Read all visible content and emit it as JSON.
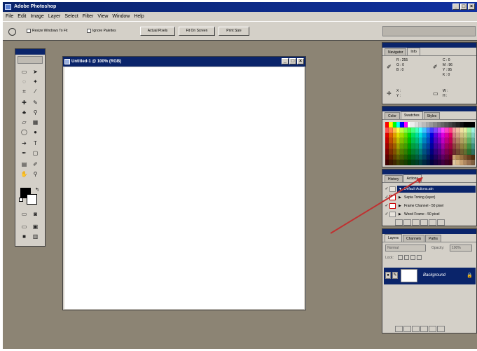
{
  "app": {
    "title": "Adobe Photoshop"
  },
  "menu": [
    "File",
    "Edit",
    "Image",
    "Layer",
    "Select",
    "Filter",
    "View",
    "Window",
    "Help"
  ],
  "options_bar": {
    "checkbox1": "Resize Windows To Fit",
    "checkbox2": "Ignore Palettes",
    "btn_actual": "Actual Pixels",
    "btn_fit": "Fit On Screen",
    "btn_print": "Print Size"
  },
  "document": {
    "title": "Untitled-1 @ 100% (RGB)"
  },
  "navigator": {
    "tabs": [
      "Navigator",
      "Info"
    ],
    "r": "R :",
    "r_val": "255",
    "g": "G :",
    "g_val": "0",
    "b": "B :",
    "b_val": "0",
    "c": "C :",
    "c_val": "0",
    "m": "M :",
    "m_val": "96",
    "y": "Y :",
    "y_val": "95",
    "k": "K :",
    "k_val": "0",
    "x": "X :",
    "y2": "Y :",
    "w": "W :",
    "h": "H :"
  },
  "color_panel": {
    "tabs": [
      "Color",
      "Swatches",
      "Styles"
    ],
    "swatches": [
      "#ff0000",
      "#ffff00",
      "#00ff00",
      "#00ffff",
      "#0000ff",
      "#ff00ff",
      "#ffffff",
      "#eeeeee",
      "#dddddd",
      "#cccccc",
      "#bbbbbb",
      "#aaaaaa",
      "#999999",
      "#888888",
      "#777777",
      "#666666",
      "#555555",
      "#444444",
      "#333333",
      "#222222",
      "#111111",
      "#000000",
      "#000000",
      "#000000",
      "#ff4d4d",
      "#ff8040",
      "#ffc040",
      "#ffff40",
      "#c0ff40",
      "#80ff40",
      "#40ff40",
      "#40ff80",
      "#40ffc0",
      "#40ffff",
      "#40c0ff",
      "#4080ff",
      "#4040ff",
      "#8040ff",
      "#c040ff",
      "#ff40ff",
      "#ff40c0",
      "#ff4080",
      "#f0a0a0",
      "#f0c0a0",
      "#f0e0a0",
      "#e0f0a0",
      "#a0f0a0",
      "#a0f0e0",
      "#e00000",
      "#e06000",
      "#e0a000",
      "#e0e000",
      "#a0e000",
      "#60e000",
      "#00e000",
      "#00e060",
      "#00e0a0",
      "#00e0e0",
      "#00a0e0",
      "#0060e0",
      "#0000e0",
      "#6000e0",
      "#a000e0",
      "#e000e0",
      "#e000a0",
      "#e00060",
      "#d08080",
      "#d0a080",
      "#d0c080",
      "#c0d080",
      "#80d080",
      "#80d0c0",
      "#c00000",
      "#c05000",
      "#c08000",
      "#c0c000",
      "#80c000",
      "#50c000",
      "#00c000",
      "#00c050",
      "#00c080",
      "#00c0c0",
      "#0080c0",
      "#0050c0",
      "#0000c0",
      "#5000c0",
      "#8000c0",
      "#c000c0",
      "#c00080",
      "#c00050",
      "#b06060",
      "#b08060",
      "#b0a060",
      "#a0b060",
      "#60b060",
      "#60b0a0",
      "#a00000",
      "#a04000",
      "#a06000",
      "#a0a000",
      "#60a000",
      "#40a000",
      "#00a000",
      "#00a040",
      "#00a060",
      "#00a0a0",
      "#0060a0",
      "#0040a0",
      "#0000a0",
      "#4000a0",
      "#6000a0",
      "#a000a0",
      "#a00060",
      "#a00040",
      "#904040",
      "#906040",
      "#908040",
      "#809040",
      "#409040",
      "#409080",
      "#800000",
      "#803000",
      "#805000",
      "#808000",
      "#508000",
      "#308000",
      "#008000",
      "#008030",
      "#008050",
      "#008080",
      "#005080",
      "#003080",
      "#000080",
      "#300080",
      "#500080",
      "#800080",
      "#800050",
      "#800030",
      "#703030",
      "#704830",
      "#706030",
      "#607030",
      "#307030",
      "#307060",
      "#600000",
      "#602000",
      "#604000",
      "#606000",
      "#406000",
      "#206000",
      "#006000",
      "#006020",
      "#006040",
      "#006060",
      "#004060",
      "#002060",
      "#000060",
      "#200060",
      "#400060",
      "#600060",
      "#600040",
      "#600020",
      "#c8a070",
      "#b08850",
      "#987040",
      "#805830",
      "#684020",
      "#503010",
      "#400000",
      "#401800",
      "#402800",
      "#404000",
      "#284000",
      "#184000",
      "#004000",
      "#004018",
      "#004028",
      "#004040",
      "#002840",
      "#001840",
      "#000040",
      "#180040",
      "#280040",
      "#400040",
      "#400028",
      "#400018",
      "#e0c8a0",
      "#d8b888",
      "#c8a070",
      "#b08860",
      "#987050",
      "#806040"
    ]
  },
  "actions_panel": {
    "tabs": [
      "History",
      "Actions"
    ],
    "rows": [
      {
        "check": "✓",
        "name": "Default Actions.atn",
        "selected": true,
        "red": false
      },
      {
        "check": "✓",
        "name": "Sepia Toning (layer)",
        "selected": false,
        "red": true
      },
      {
        "check": "✓",
        "name": "Frame Channel - 50 pixel",
        "selected": false,
        "red": true
      },
      {
        "check": "✓",
        "name": "Wood Frame - 50 pixel",
        "selected": false,
        "red": false
      }
    ]
  },
  "layers_panel": {
    "tabs": [
      "Layers",
      "Channels",
      "Paths"
    ],
    "blend_mode": "Normal",
    "opacity_label": "Opacity:",
    "opacity_value": "100%",
    "lock_label": "Lock:",
    "layer_name": "Background",
    "eye_icon": "eye-icon"
  }
}
